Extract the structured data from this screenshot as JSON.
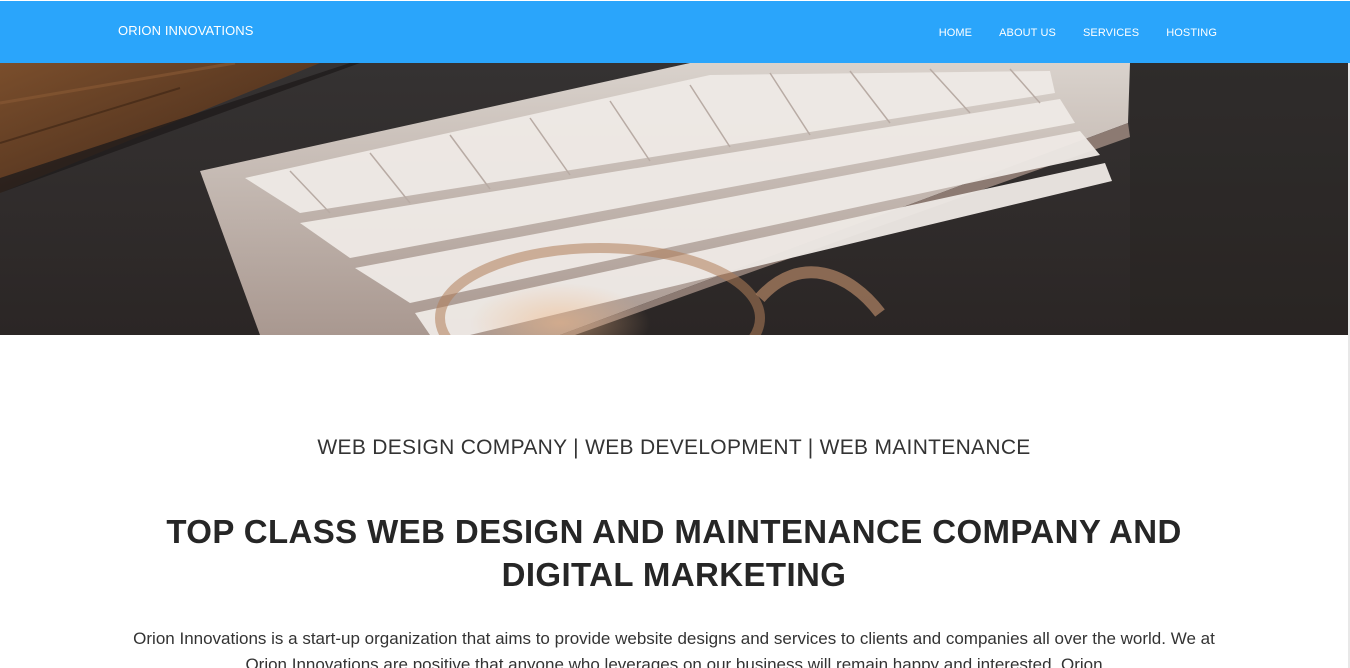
{
  "navbar": {
    "brand": "ORION INNOVATIONS",
    "items": [
      {
        "label": "HOME"
      },
      {
        "label": "ABOUT US"
      },
      {
        "label": "SERVICES"
      },
      {
        "label": "HOSTING"
      }
    ]
  },
  "hero": {
    "image": "keyboard-and-glasses-photo"
  },
  "content": {
    "tagline": "WEB DESIGN COMPANY | WEB DEVELOPMENT | WEB MAINTENANCE",
    "headline": "TOP CLASS WEB DESIGN AND MAINTENANCE COMPANY AND DIGITAL MARKETING",
    "intro": "Orion Innovations is a start-up organization that aims to provide website designs and services to clients and companies all over the world. We at Orion Innovations are positive that anyone who leverages on our business will remain happy and interested. Orion"
  },
  "colors": {
    "navbar_bg": "#2aa5fb",
    "text_dark": "#262626"
  }
}
